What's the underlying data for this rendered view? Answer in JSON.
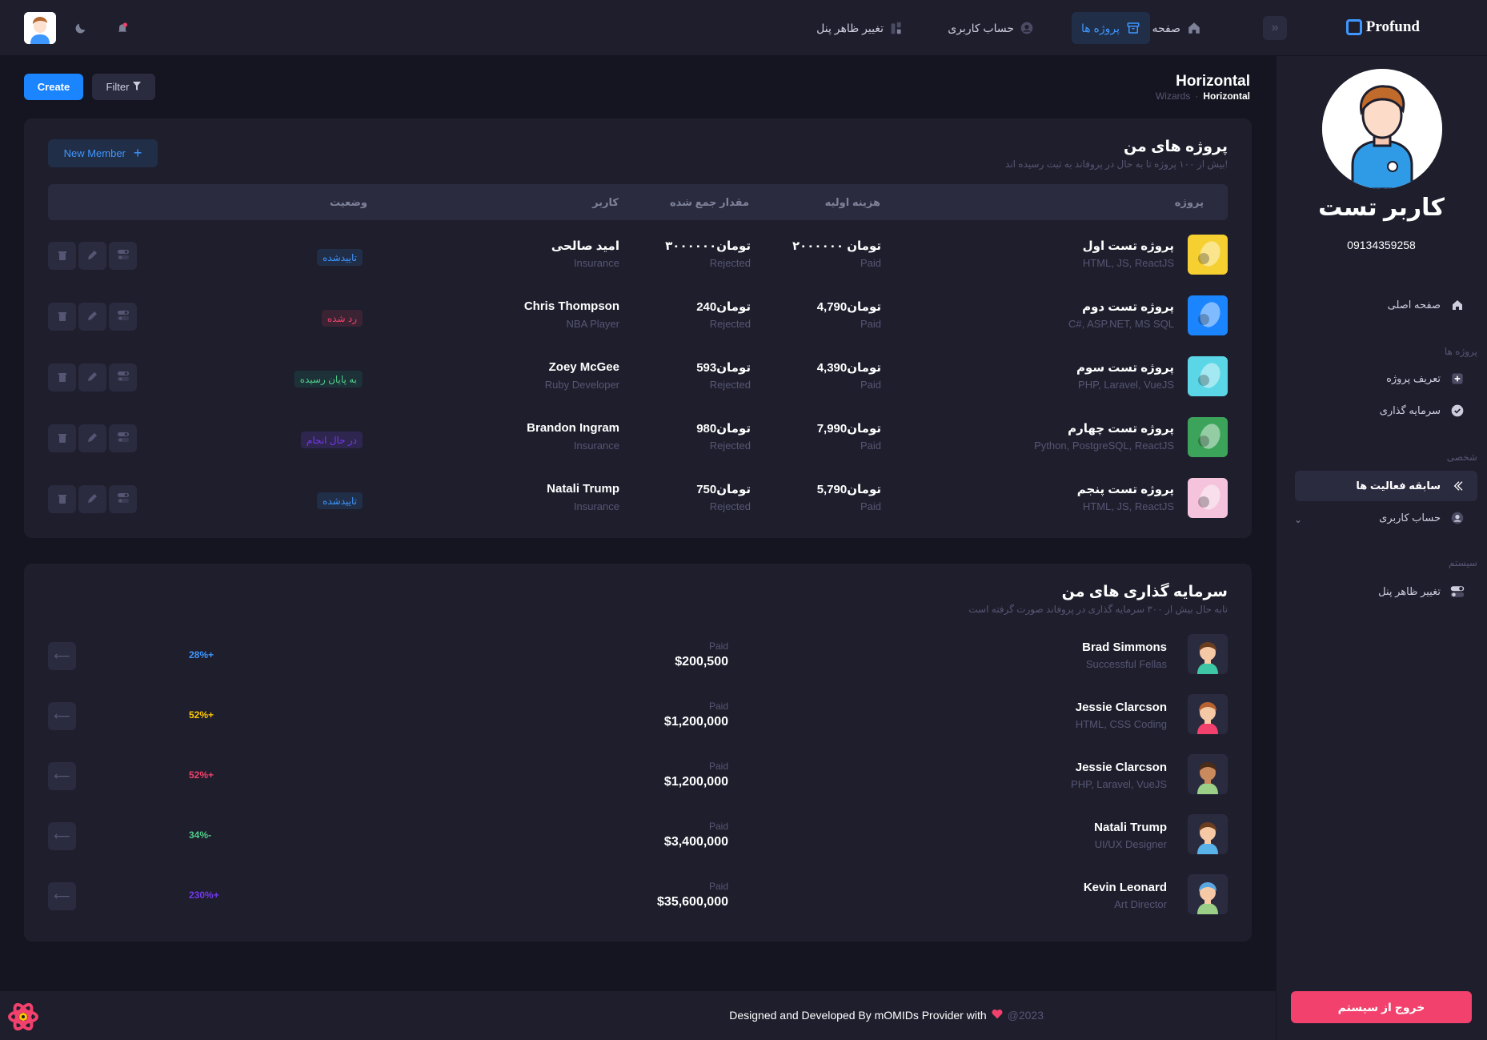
{
  "brand": {
    "name": "Profund"
  },
  "topnav": {
    "items": [
      {
        "label": "صفحه اصلی",
        "icon": "home-icon"
      },
      {
        "label": "پروژه ها",
        "icon": "box-icon"
      },
      {
        "label": "حساب کاربری",
        "icon": "user-icon"
      },
      {
        "label": "تغییر ظاهر پنل",
        "icon": "chart-icon"
      }
    ]
  },
  "toolbar": {
    "create_label": "Create",
    "filter_label": "Filter"
  },
  "page": {
    "title": "Horizontal",
    "breadcrumb": {
      "current": "Horizontal",
      "parent": "Wizards"
    }
  },
  "projects": {
    "title": "پروژه های من",
    "subtitle": "بیش از ۱۰۰ پروژه تا به حال در پروفاند به ثبت رسیده اند!",
    "new_member_label": "New Member",
    "columns": {
      "project": "پروژه",
      "initial_cost": "هزینه اولیه",
      "collected": "مقدار جمع شده",
      "user": "کاربر",
      "status": "وضعیت"
    },
    "rows": [
      {
        "name": "پروژه تست اول",
        "tech": "HTML, JS, ReactJS",
        "cost": "۲۰۰۰۰۰۰ تومان",
        "cost_sub": "Paid",
        "collected": "۳۰۰۰۰۰۰تومان",
        "collected_sub": "Rejected",
        "user": "امید صالحی",
        "user_sub": "Insurance",
        "status": "تاییدشده",
        "status_color": "#3e97ff",
        "status_bg": "#212e48",
        "thumb_color": "#f6d030"
      },
      {
        "name": "پروژه تست دوم",
        "tech": "C#, ASP.NET, MS SQL",
        "cost": "تومان4,790",
        "cost_sub": "Paid",
        "collected": "تومان240",
        "collected_sub": "Rejected",
        "user": "Chris Thompson",
        "user_sub": "NBA Player",
        "status": "رد شده",
        "status_color": "#f1416c",
        "status_bg": "#3a2434",
        "thumb_color": "#1b84ff"
      },
      {
        "name": "پروژه تست سوم",
        "tech": "PHP, Laravel, VueJS",
        "cost": "تومان4,390",
        "cost_sub": "Paid",
        "collected": "تومان593",
        "collected_sub": "Rejected",
        "user": "Zoey McGee",
        "user_sub": "Ruby Developer",
        "status": "به پایان رسیده",
        "status_color": "#50cd89",
        "status_bg": "#1c3238",
        "thumb_color": "#5ad6e6"
      },
      {
        "name": "پروژه تست چهارم",
        "tech": "Python, PostgreSQL, ReactJS",
        "cost": "تومان7,990",
        "cost_sub": "Paid",
        "collected": "تومان980",
        "collected_sub": "Rejected",
        "user": "Brandon Ingram",
        "user_sub": "Insurance",
        "status": "در حال انجام",
        "status_color": "#7239ea",
        "status_bg": "#2f264f",
        "thumb_color": "#3ca45a"
      },
      {
        "name": "پروژه تست پنجم",
        "tech": "HTML, JS, ReactJS",
        "cost": "تومان5,790",
        "cost_sub": "Paid",
        "collected": "تومان750",
        "collected_sub": "Rejected",
        "user": "Natali Trump",
        "user_sub": "Insurance",
        "status": "تاییدشده",
        "status_color": "#3e97ff",
        "status_bg": "#212e48",
        "thumb_color": "#f5c3dc"
      }
    ]
  },
  "investments": {
    "title": "سرمایه گذاری های من",
    "subtitle": "تابه حال بیش از ۳۰۰ سرمایه گذاری در پروفاند صورت گرفته است",
    "rows": [
      {
        "name": "Brad Simmons",
        "role": "Successful Fellas",
        "paid_label": "Paid",
        "amount": "$200,500",
        "change": "28%+",
        "change_color": "#3e97ff",
        "shirt": "#3fc6a4",
        "hair": "#6b3d1f",
        "skin": "#f6c9a6"
      },
      {
        "name": "Jessie Clarcson",
        "role": "HTML, CSS Coding",
        "paid_label": "Paid",
        "amount": "$1,200,000",
        "change": "52%+",
        "change_color": "#ffc700",
        "shirt": "#f1416c",
        "hair": "#b6612f",
        "skin": "#f6c9a6"
      },
      {
        "name": "Jessie Clarcson",
        "role": "PHP, Laravel, VueJS",
        "paid_label": "Paid",
        "amount": "$1,200,000",
        "change": "52%+",
        "change_color": "#f1416c",
        "shirt": "#9bcf88",
        "hair": "#4a2b17",
        "skin": "#c98a5e"
      },
      {
        "name": "Natali Trump",
        "role": "UI/UX Designer",
        "paid_label": "Paid",
        "amount": "$3,400,000",
        "change": "34%-",
        "change_color": "#50cd89",
        "shirt": "#5ab3e8",
        "hair": "#6b3d1f",
        "skin": "#f6c9a6"
      },
      {
        "name": "Kevin Leonard",
        "role": "Art Director",
        "paid_label": "Paid",
        "amount": "$35,600,000",
        "change": "230%+",
        "change_color": "#7239ea",
        "shirt": "#9bcf88",
        "hair": "#5aa6e0",
        "skin": "#f6c9a6"
      }
    ]
  },
  "profile": {
    "name": "کاربر تست",
    "phone": "09134359258"
  },
  "sidebar": {
    "home": "صفحه اصلی",
    "sec_projects": "پروژه ها",
    "define_project": "تعریف پروژه",
    "investment": "سرمایه گذاری",
    "sec_personal": "شخصی",
    "activity": "سابقه فعالیت ها",
    "account": "حساب کاربری",
    "sec_system": "سیستم",
    "theme": "تغییر ظاهر پنل"
  },
  "footer": {
    "credit": "Designed and Developed By mOMIDs Provider with",
    "year": "@2023",
    "logout": "خروج از سیستم"
  },
  "colors": {
    "accent": "#1b84ff",
    "danger": "#f1416c",
    "bg": "#151521",
    "card": "#1e1e2d"
  }
}
